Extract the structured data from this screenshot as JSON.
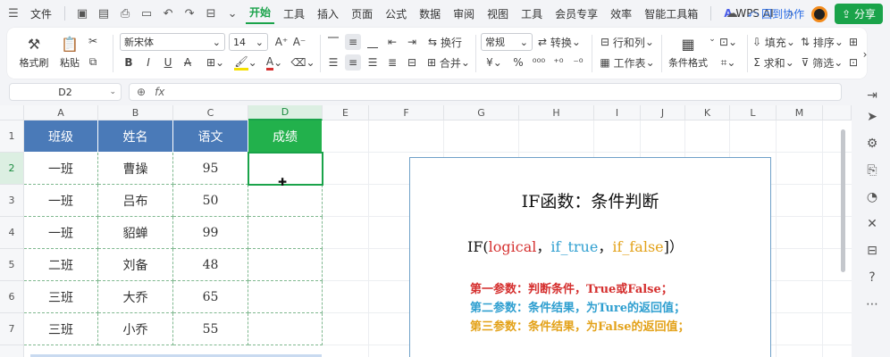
{
  "menubar": {
    "file": "文件",
    "tabs": [
      "开始",
      "工具",
      "插入",
      "页面",
      "公式",
      "数据",
      "审阅",
      "视图",
      "工具",
      "会员专享",
      "效率",
      "智能工具箱"
    ],
    "active_tab": "开始",
    "wps_ai": "WPS AI",
    "collab": "回到协作",
    "share": "分享"
  },
  "ribbon": {
    "format_painter": "格式刷",
    "paste": "粘贴",
    "font_name": "新宋体",
    "font_size": "14",
    "wrap": "换行",
    "merge": "合并",
    "number_format": "常规",
    "convert": "转换",
    "row_col": "行和列",
    "worksheet": "工作表",
    "cond_format": "条件格式",
    "fill": "填充",
    "sort": "排序",
    "sum": "求和",
    "filter": "筛选"
  },
  "namebox": "D2",
  "fx": "fx",
  "columns": [
    "A",
    "B",
    "C",
    "D",
    "E",
    "F",
    "G",
    "H",
    "I",
    "J",
    "K",
    "L",
    "M"
  ],
  "rows": [
    "1",
    "2",
    "3",
    "4",
    "5",
    "6",
    "7"
  ],
  "table": {
    "headers": [
      "班级",
      "姓名",
      "语文",
      "成绩"
    ],
    "rows": [
      [
        "一班",
        "曹操",
        "95",
        ""
      ],
      [
        "一班",
        "吕布",
        "50",
        ""
      ],
      [
        "一班",
        "貂蝉",
        "99",
        ""
      ],
      [
        "二班",
        "刘备",
        "48",
        ""
      ],
      [
        "三班",
        "大乔",
        "65",
        ""
      ],
      [
        "三班",
        "小乔",
        "55",
        ""
      ]
    ]
  },
  "textbox": {
    "title": "IF函数：条件判断",
    "formula_prefix": "IF(",
    "arg1": "logical",
    "comma1": "，",
    "arg2": "if_true",
    "comma2": "，",
    "arg3": "if_false",
    "formula_suffix": "]）",
    "line1": "第一参数：判断条件，True或False；",
    "line2": "第二参数：条件结果，为Ture的返回值；",
    "line3": "第三参数：条件结果，为False的返回值；"
  },
  "colors": {
    "accent": "#1aa34a",
    "header_blue": "#4a7ab8",
    "header_green": "#22b14c",
    "red": "#d5302f",
    "blue": "#2f9fd0",
    "yellow": "#e3a21a"
  }
}
